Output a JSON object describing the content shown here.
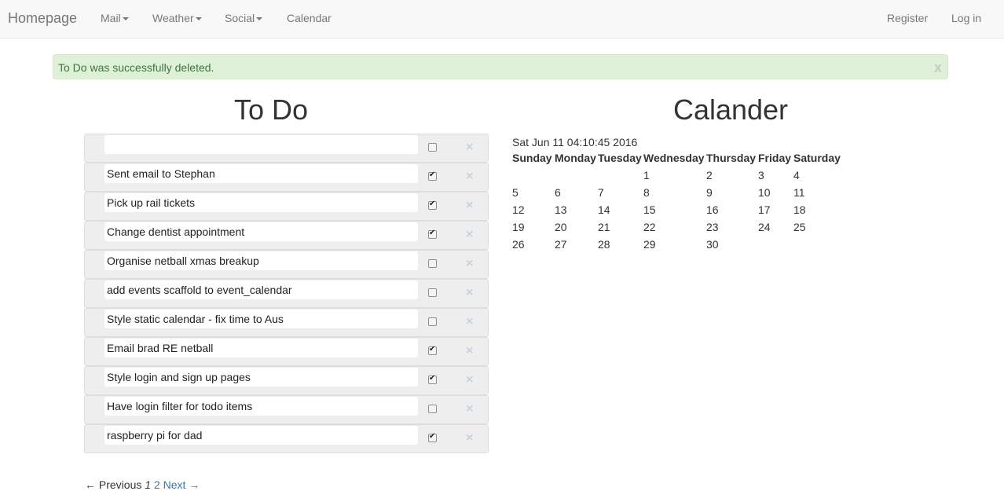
{
  "navbar": {
    "brand": "Homepage",
    "items": [
      {
        "label": "Mail",
        "dropdown": true
      },
      {
        "label": "Weather",
        "dropdown": true
      },
      {
        "label": "Social",
        "dropdown": true
      },
      {
        "label": "Calendar",
        "dropdown": false
      }
    ],
    "right": [
      {
        "label": "Register"
      },
      {
        "label": "Log in"
      }
    ]
  },
  "alert": {
    "message": "To Do was successfully deleted.",
    "close": "x"
  },
  "todo": {
    "title": "To Do",
    "items": [
      {
        "text": "",
        "checked": false
      },
      {
        "text": "Sent email to Stephan",
        "checked": true
      },
      {
        "text": "Pick up rail tickets",
        "checked": true
      },
      {
        "text": "Change dentist appointment",
        "checked": true
      },
      {
        "text": "Organise netball xmas breakup",
        "checked": false
      },
      {
        "text": "add events scaffold to event_calendar",
        "checked": false
      },
      {
        "text": "Style static calendar - fix time to Aus",
        "checked": false
      },
      {
        "text": "Email brad RE netball",
        "checked": true
      },
      {
        "text": "Style login and sign up pages",
        "checked": true
      },
      {
        "text": "Have login filter for todo items",
        "checked": false
      },
      {
        "text": "raspberry pi for dad",
        "checked": true
      }
    ],
    "delete_glyph": "×"
  },
  "pagination": {
    "previous": "← Previous",
    "current": "1",
    "next_page": "2",
    "next": "Next →"
  },
  "calendar": {
    "title": "Calander",
    "timestamp": "Sat Jun 11 04:10:45 2016",
    "days": [
      "Sunday",
      "Monday",
      "Tuesday",
      "Wednesday",
      "Thursday",
      "Friday",
      "Saturday"
    ],
    "weeks": [
      [
        "",
        "",
        "",
        "1",
        "2",
        "3",
        "4"
      ],
      [
        "5",
        "6",
        "7",
        "8",
        "9",
        "10",
        "11"
      ],
      [
        "12",
        "13",
        "14",
        "15",
        "16",
        "17",
        "18"
      ],
      [
        "19",
        "20",
        "21",
        "22",
        "23",
        "24",
        "25"
      ],
      [
        "26",
        "27",
        "28",
        "29",
        "30",
        "",
        ""
      ]
    ]
  }
}
